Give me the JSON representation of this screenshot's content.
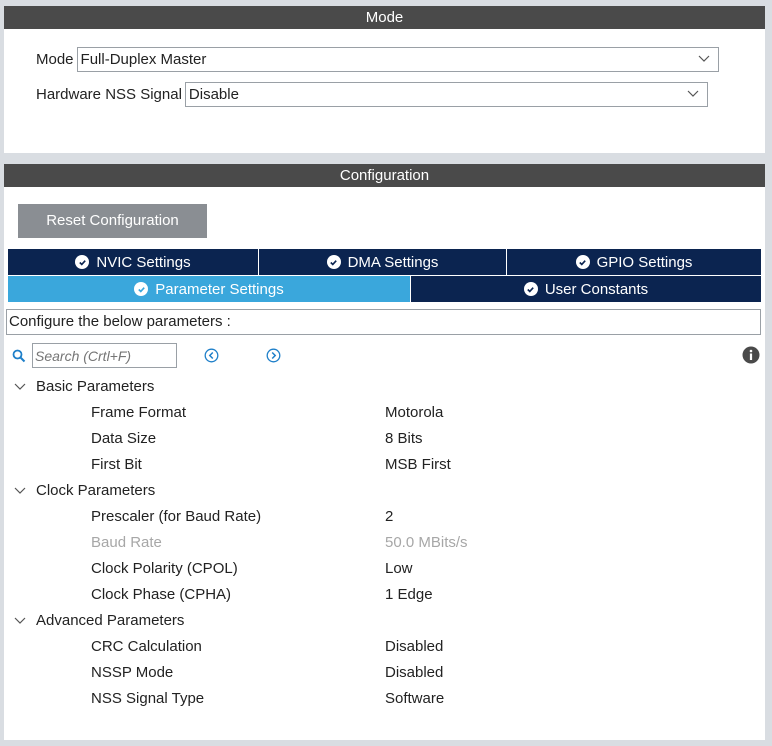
{
  "mode_panel": {
    "header": "Mode",
    "fields": [
      {
        "label": "Mode",
        "value": "Full-Duplex Master"
      },
      {
        "label": "Hardware NSS Signal",
        "value": "Disable"
      }
    ]
  },
  "config_panel": {
    "header": "Configuration",
    "reset_label": "Reset Configuration",
    "tabs_row1": [
      {
        "label": "NVIC Settings",
        "icon": "check-circle-icon"
      },
      {
        "label": "DMA Settings",
        "icon": "check-circle-icon"
      },
      {
        "label": "GPIO Settings",
        "icon": "check-circle-icon"
      }
    ],
    "tabs_row2": [
      {
        "label": "Parameter Settings",
        "icon": "check-circle-icon",
        "active": true
      },
      {
        "label": "User Constants",
        "icon": "check-circle-icon",
        "active": false
      }
    ],
    "description": "Configure the below parameters :",
    "search": {
      "placeholder": "Search (Crtl+F)"
    },
    "groups": [
      {
        "name": "Basic Parameters",
        "params": [
          {
            "name": "Frame Format",
            "value": "Motorola"
          },
          {
            "name": "Data Size",
            "value": "8 Bits"
          },
          {
            "name": "First Bit",
            "value": "MSB First"
          }
        ]
      },
      {
        "name": "Clock Parameters",
        "params": [
          {
            "name": "Prescaler (for Baud Rate)",
            "value": "2"
          },
          {
            "name": "Baud Rate",
            "value": "50.0 MBits/s",
            "disabled": true
          },
          {
            "name": "Clock Polarity (CPOL)",
            "value": "Low"
          },
          {
            "name": "Clock Phase (CPHA)",
            "value": "1 Edge"
          }
        ]
      },
      {
        "name": "Advanced Parameters",
        "params": [
          {
            "name": "CRC Calculation",
            "value": "Disabled"
          },
          {
            "name": "NSSP Mode",
            "value": "Disabled"
          },
          {
            "name": "NSS Signal Type",
            "value": "Software"
          }
        ]
      }
    ]
  },
  "colors": {
    "header_bg": "#4a4a4a",
    "tab_bg": "#0b2450",
    "tab_active_bg": "#3aa7dc",
    "button_bg": "#8a8e93",
    "disabled_text": "#a7a7a7"
  }
}
